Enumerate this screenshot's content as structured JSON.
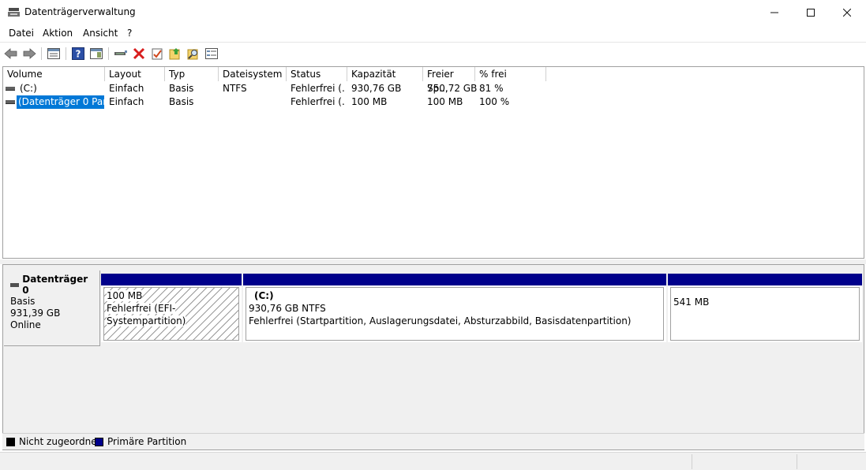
{
  "window": {
    "title": "Datenträgerverwaltung",
    "min_icon": "minimize-icon",
    "max_icon": "maximize-icon",
    "close_icon": "close-icon"
  },
  "menu": {
    "items": [
      "Datei",
      "Aktion",
      "Ansicht",
      "?"
    ]
  },
  "toolbar": {
    "icons": [
      "back-icon",
      "forward-icon",
      "list-view-icon",
      "help-icon",
      "properties-pane-icon",
      "connect-icon",
      "delete-icon",
      "check-icon",
      "export-icon",
      "search-icon",
      "settings-icon"
    ]
  },
  "volume_list": {
    "columns": [
      "Volume",
      "Layout",
      "Typ",
      "Dateisystem",
      "Status",
      "Kapazität",
      "Freier Sp...",
      "% frei"
    ],
    "rows": [
      {
        "volume": "(C:)",
        "layout": "Einfach",
        "typ": "Basis",
        "dateisystem": "NTFS",
        "status": "Fehlerfrei (...",
        "kapazitaet": "930,76 GB",
        "freier": "750,72 GB",
        "frei_pct": "81 %"
      },
      {
        "volume": "(Datenträger 0 Par...",
        "layout": "Einfach",
        "typ": "Basis",
        "dateisystem": "",
        "status": "Fehlerfrei (...",
        "kapazitaet": "100 MB",
        "freier": "100 MB",
        "frei_pct": "100 %"
      }
    ]
  },
  "disk": {
    "name": "Datenträger 0",
    "type": "Basis",
    "size": "931,39 GB",
    "state": "Online",
    "partitions": [
      {
        "name": "",
        "size": "100 MB",
        "status": "Fehlerfrei (EFI-Systempartition)"
      },
      {
        "name": "(C:)",
        "size": "930,76 GB NTFS",
        "status": "Fehlerfrei (Startpartition, Auslagerungsdatei, Absturzabbild, Basisdatenpartition)"
      },
      {
        "name": "",
        "size": "541 MB",
        "status": ""
      }
    ]
  },
  "legend": {
    "unallocated": "Nicht zugeordnet",
    "primary": "Primäre Partition",
    "unallocated_color": "#000000",
    "primary_color": "#00008b"
  },
  "colors": {
    "partition_bar": "#00008b",
    "selection": "#0078d7"
  }
}
